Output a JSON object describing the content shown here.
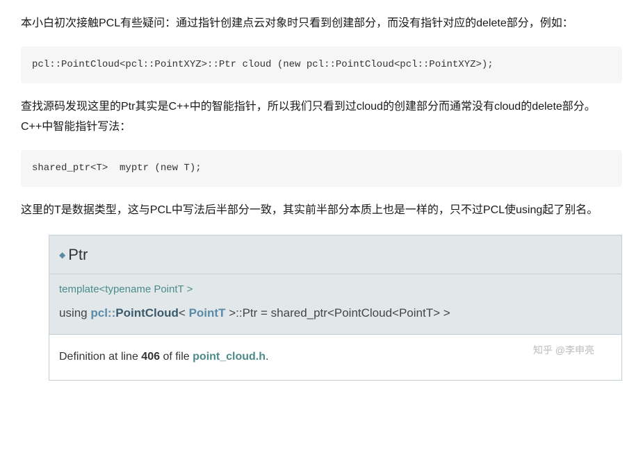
{
  "paragraphs": {
    "p1": "本小白初次接触PCL有些疑问：通过指针创建点云对象时只看到创建部分，而没有指针对应的delete部分，例如：",
    "p2": "查找源码发现这里的Ptr其实是C++中的智能指针，所以我们只看到过cloud的创建部分而通常没有cloud的delete部分。C++中智能指针写法：",
    "p3": "这里的T是数据类型，这与PCL中写法后半部分一致，其实前半部分本质上也是一样的，只不过PCL使using起了别名。"
  },
  "code": {
    "c1": "pcl::PointCloud<pcl::PointXYZ>::Ptr cloud (new pcl::PointCloud<pcl::PointXYZ>);",
    "c2": "shared_ptr<T>  myptr (new T);"
  },
  "docbox": {
    "bullet": "◆",
    "title": "Ptr",
    "template_line": "template<typename PointT >",
    "using_kw": "using ",
    "using_ns": "pcl::",
    "using_cls": "PointCloud",
    "using_lt": "< ",
    "using_tparam": "PointT",
    "using_gt": " >",
    "using_ptr": "::Ptr",
    "using_eq": " = shared_ptr<PointCloud<PointT> >",
    "def_prefix": "Definition at line ",
    "def_line": "406",
    "def_mid": " of file ",
    "def_file": "point_cloud.h",
    "def_suffix": "."
  },
  "watermark": "知乎 @李申亮"
}
